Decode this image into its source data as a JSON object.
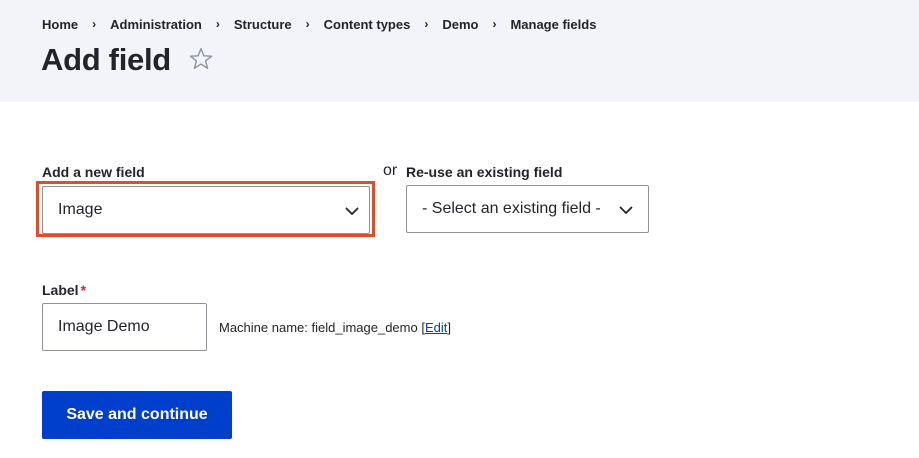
{
  "breadcrumb": [
    "Home",
    "Administration",
    "Structure",
    "Content types",
    "Demo",
    "Manage fields"
  ],
  "page_title": "Add field",
  "icons": {
    "favorite": "star-outline-icon",
    "dropdown": "chevron-down-icon",
    "separator": "chevron-right-icon"
  },
  "form": {
    "new_field_label": "Add a new field",
    "new_field_value": "Image",
    "or_text": "or",
    "existing_field_label": "Re-use an existing field",
    "existing_field_value": "- Select an existing field -",
    "label_label": "Label",
    "required_marker": "*",
    "label_value": "Image Demo",
    "machine_name_prefix": "Machine name: field_image_demo",
    "machine_name_bracket_open": "[",
    "machine_name_edit": "Edit",
    "machine_name_bracket_close": "]",
    "submit_label": "Save and continue"
  },
  "colors": {
    "header_bg": "#f3f4f9",
    "primary": "#003ecc",
    "highlight": "#e34d25",
    "required": "#dc2323"
  }
}
